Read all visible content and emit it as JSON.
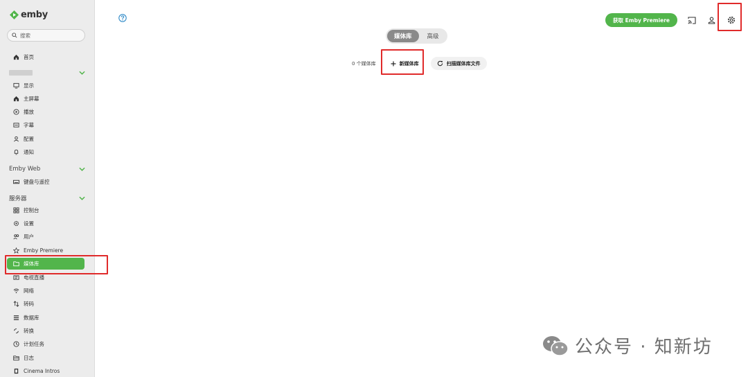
{
  "app": {
    "logo_text": "emby"
  },
  "search": {
    "placeholder": "搜索"
  },
  "sidebar": {
    "home": "首页",
    "section_user": {
      "items": [
        "显示",
        "主屏幕",
        "播放",
        "字幕",
        "配置",
        "通知"
      ]
    },
    "section_web": {
      "title": "Emby Web",
      "items": [
        "键盘与遥控"
      ]
    },
    "section_server": {
      "title": "服务器",
      "items": [
        "控制台",
        "设置",
        "用户",
        "Emby Premiere",
        "媒体库",
        "电视直播",
        "网络",
        "转码",
        "数据库",
        "转换",
        "计划任务",
        "日志",
        "Cinema Intros"
      ]
    },
    "active_item": "媒体库"
  },
  "header": {
    "premiere_button": "获取 Emby Premiere"
  },
  "tabs": [
    {
      "label": "媒体库",
      "active": true
    },
    {
      "label": "高级",
      "active": false
    }
  ],
  "library": {
    "count_text": "0 个媒体库",
    "new_button": "新媒体库",
    "scan_button": "扫描媒体库文件"
  },
  "watermark": {
    "text": "公众号 · 知新坊"
  },
  "colors": {
    "accent": "#52b54b",
    "highlight": "#e02a2a"
  }
}
